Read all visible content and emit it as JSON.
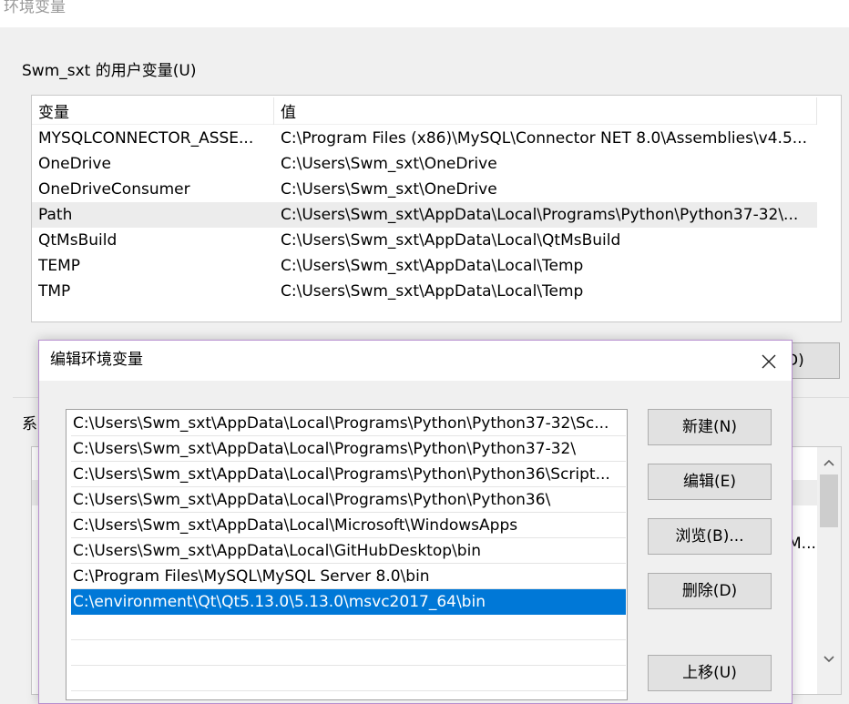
{
  "window": {
    "title": "环境变量"
  },
  "user_vars": {
    "group_label": "Swm_sxt 的用户变量(U)",
    "columns": [
      "变量",
      "值"
    ],
    "rows": [
      {
        "name": "MYSQLCONNECTOR_ASSE...",
        "value": "C:\\Program Files (x86)\\MySQL\\Connector NET 8.0\\Assemblies\\v4.5..."
      },
      {
        "name": "OneDrive",
        "value": "C:\\Users\\Swm_sxt\\OneDrive"
      },
      {
        "name": "OneDriveConsumer",
        "value": "C:\\Users\\Swm_sxt\\OneDrive"
      },
      {
        "name": "Path",
        "value": "C:\\Users\\Swm_sxt\\AppData\\Local\\Programs\\Python\\Python37-32\\..."
      },
      {
        "name": "QtMsBuild",
        "value": "C:\\Users\\Swm_sxt\\AppData\\Local\\QtMsBuild"
      },
      {
        "name": "TEMP",
        "value": "C:\\Users\\Swm_sxt\\AppData\\Local\\Temp"
      },
      {
        "name": "TMP",
        "value": "C:\\Users\\Swm_sxt\\AppData\\Local\\Temp"
      }
    ],
    "selected_index": 3,
    "partial_button_label": "D)"
  },
  "system_vars": {
    "label_fragment": "系",
    "row_fragment": "M..."
  },
  "dialog": {
    "title": "编辑环境变量",
    "paths": [
      "C:\\Users\\Swm_sxt\\AppData\\Local\\Programs\\Python\\Python37-32\\Sc...",
      "C:\\Users\\Swm_sxt\\AppData\\Local\\Programs\\Python\\Python37-32\\",
      "C:\\Users\\Swm_sxt\\AppData\\Local\\Programs\\Python\\Python36\\Script...",
      "C:\\Users\\Swm_sxt\\AppData\\Local\\Programs\\Python\\Python36\\",
      "C:\\Users\\Swm_sxt\\AppData\\Local\\Microsoft\\WindowsApps",
      "C:\\Users\\Swm_sxt\\AppData\\Local\\GitHubDesktop\\bin",
      "C:\\Program Files\\MySQL\\MySQL Server 8.0\\bin",
      "C:\\environment\\Qt\\Qt5.13.0\\5.13.0\\msvc2017_64\\bin"
    ],
    "selected_index": 7,
    "buttons": {
      "new": "新建(N)",
      "edit": "编辑(E)",
      "browse": "浏览(B)...",
      "delete": "删除(D)",
      "move_up": "上移(U)"
    }
  },
  "colors": {
    "selection": "#0078d7",
    "dialog_border": "#b78fcf",
    "window_bg": "#f0f0f0"
  },
  "icons": [
    "close-icon",
    "scroll-up-arrow-icon",
    "scroll-down-arrow-icon"
  ]
}
